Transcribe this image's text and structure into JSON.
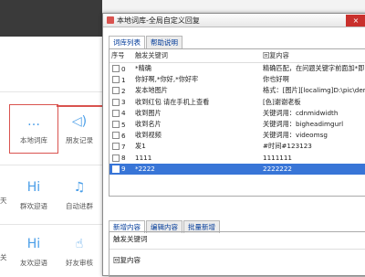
{
  "dialog": {
    "title": "本地词库-全局自定义回复",
    "close_icon": "×",
    "tabs": [
      "词库列表",
      "帮助说明"
    ],
    "columns": [
      "序号",
      "触发关键词",
      "回复内容"
    ],
    "rows": [
      {
        "n": "0",
        "k": "*精确",
        "r": "精确匹配，在问题关键字前面加*即"
      },
      {
        "n": "1",
        "k": "你好啊,*你好,*你好牢",
        "r": "你也好啊"
      },
      {
        "n": "2",
        "k": "发本地图片",
        "r": "格式：[图片][localimg]D:\\pic\\demo"
      },
      {
        "n": "3",
        "k": "收到红包 请在手机上查看",
        "r": "[色]谢谢老板"
      },
      {
        "n": "4",
        "k": "收到图片",
        "r": "关键词用：cdnmidwidth"
      },
      {
        "n": "5",
        "k": "收到名片",
        "r": "关键词用：bigheadimgurl"
      },
      {
        "n": "6",
        "k": "收到视频",
        "r": "关键词用：videomsg"
      },
      {
        "n": "7",
        "k": "发1",
        "r": "#时间#123123"
      },
      {
        "n": "8",
        "k": "1111",
        "r": "1111111"
      },
      {
        "n": "9",
        "k": "*2222",
        "r": "2222222"
      }
    ],
    "edit_tabs": [
      "新增内容",
      "编辑内容",
      "批量新增"
    ],
    "keyword_label": "触发关键词",
    "reply_label": "回复内容"
  },
  "background": {
    "tiles": [
      {
        "label": "本地词库",
        "icon": "chat-bubble-icon",
        "glyph": "…"
      },
      {
        "label": "朋友记录",
        "icon": "speaker-icon",
        "glyph": "◁)"
      },
      {
        "label": "群欢迎语",
        "icon": "hi-icon",
        "glyph": "Hi"
      },
      {
        "label": "自动进群",
        "icon": "bell-icon",
        "glyph": "♫"
      },
      {
        "label": "友欢迎语",
        "icon": "hi-icon",
        "glyph": "Hi"
      },
      {
        "label": "好友审核",
        "icon": "tap-icon",
        "glyph": "☝"
      }
    ],
    "partial_left_labels": [
      "天",
      "关"
    ]
  },
  "colors": {
    "accent": "#4a9ee8",
    "highlight": "#d9534f",
    "selected_row": "#3875d7"
  }
}
